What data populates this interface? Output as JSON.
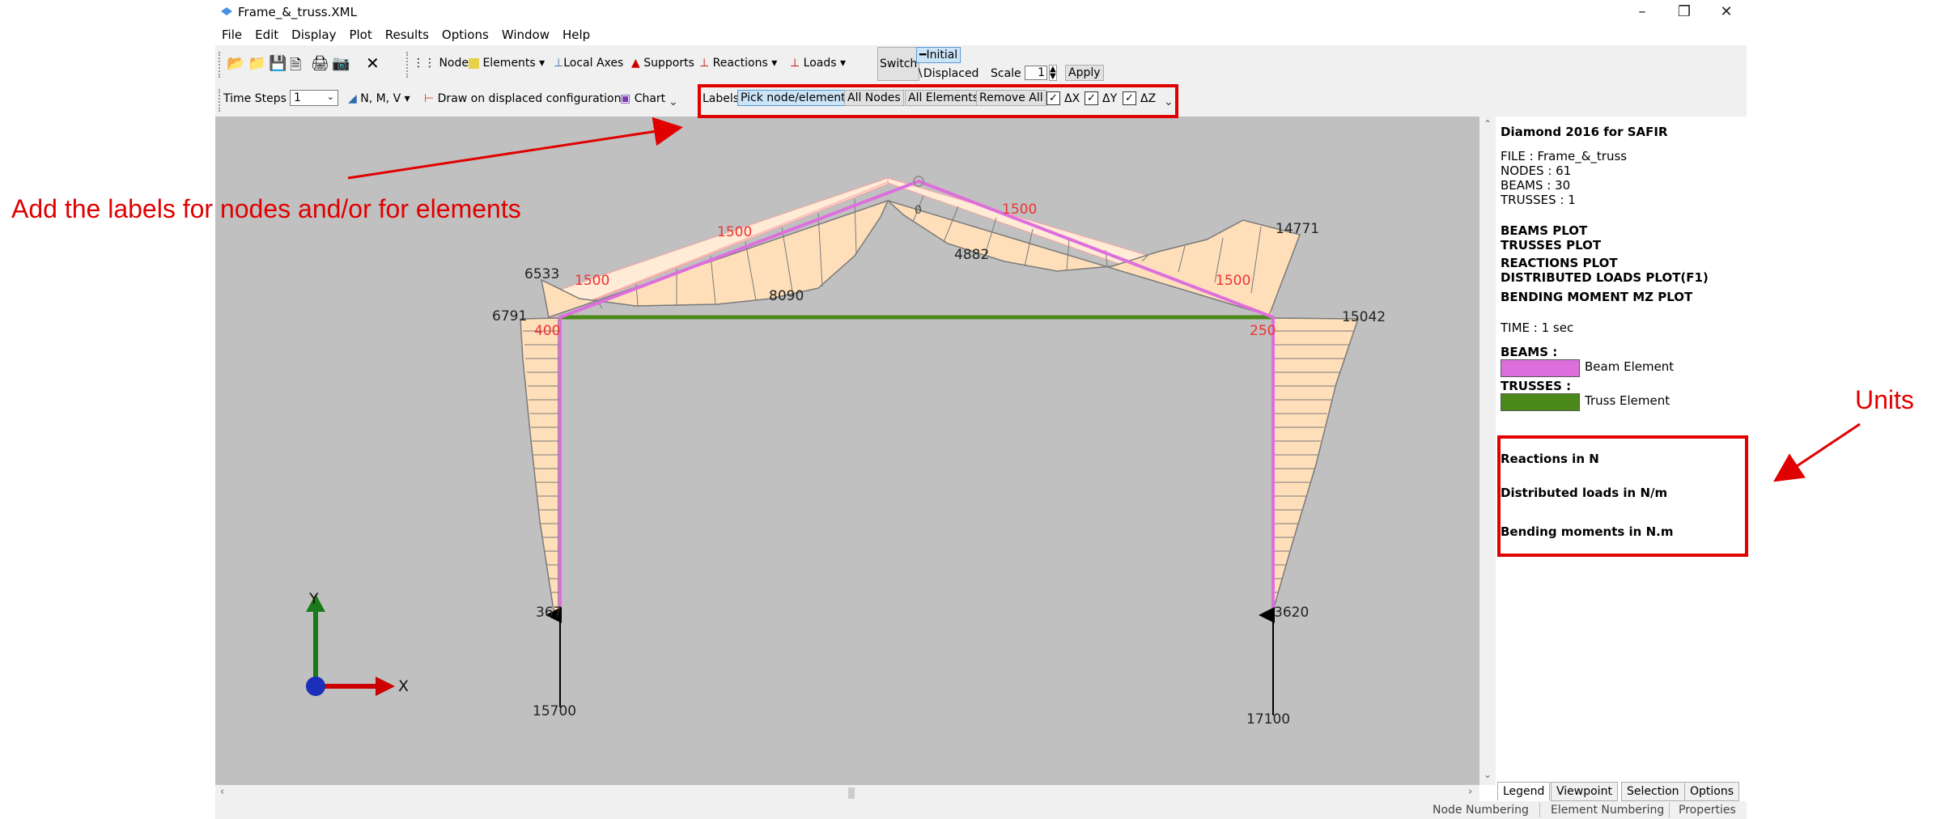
{
  "window": {
    "title": "Frame_&_truss.XML"
  },
  "menu": [
    "File",
    "Edit",
    "Display",
    "Plot",
    "Results",
    "Options",
    "Window",
    "Help"
  ],
  "toolbar1": {
    "nodes": "Nodes",
    "elements": "Elements",
    "local_axes": "Local Axes",
    "supports": "Supports",
    "reactions": "Reactions",
    "loads": "Loads",
    "switch": "Switch",
    "initial": "Initial",
    "displaced": "Displaced",
    "scale": "Scale",
    "scale_value": "1",
    "apply": "Apply"
  },
  "toolbar2": {
    "time_steps": "Time Steps",
    "time_steps_value": "1",
    "nmv": "N, M, V",
    "draw_displaced": "Draw on displaced configuration",
    "chart": "Chart",
    "labels": "Labels",
    "pick": "Pick node/element",
    "all_nodes": "All Nodes",
    "all_elements": "All Elements",
    "remove_all": "Remove All",
    "dx": "ΔX",
    "dy": "ΔY",
    "dz": "ΔZ"
  },
  "canvas_labels": {
    "n_6533": "6533",
    "n_6791": "6791",
    "n_8090": "8090",
    "n_4882": "4882",
    "n_14771": "14771",
    "n_15042": "15042",
    "n_367": "367",
    "n_3620": "3620",
    "n_15700": "15700",
    "n_17100": "17100",
    "n_zero": "0",
    "load_1500_a": "1500",
    "load_1500_b": "1500",
    "load_1500_c": "1500",
    "load_1500_d": "1500",
    "load_400": "400",
    "load_250": "250",
    "axis_x": "X",
    "axis_y": "Y"
  },
  "legend": {
    "title": "Diamond 2016 for SAFIR",
    "file": "FILE : Frame_&_truss",
    "nodes": "NODES : 61",
    "beams": "BEAMS : 30",
    "trusses": "TRUSSES : 1",
    "beams_plot": "BEAMS PLOT",
    "trusses_plot": "TRUSSES PLOT",
    "reactions_plot": "REACTIONS PLOT",
    "dist_plot": "DISTRIBUTED LOADS PLOT(F1)",
    "bending_plot": "BENDING MOMENT MZ PLOT",
    "time": "TIME : 1 sec",
    "beams_hdr": "BEAMS :",
    "beam_el": "Beam Element",
    "trusses_hdr": "TRUSSES :",
    "truss_el": "Truss Element",
    "reactions_units": "Reactions in N",
    "dist_units": "Distributed loads in N/m",
    "bending_units": "Bending moments in N.m"
  },
  "tabs": [
    "Legend",
    "Viewpoint",
    "Selection",
    "Options"
  ],
  "status": [
    "Node Numbering",
    "Element Numbering",
    "Properties"
  ],
  "annotations": {
    "left": "Add the labels for nodes and/or for elements",
    "right": "Units"
  },
  "colors": {
    "beam": "#dd6fdd",
    "truss": "#4b8a1a",
    "diagram": "#ffdfba",
    "highlight": "#e00000"
  }
}
